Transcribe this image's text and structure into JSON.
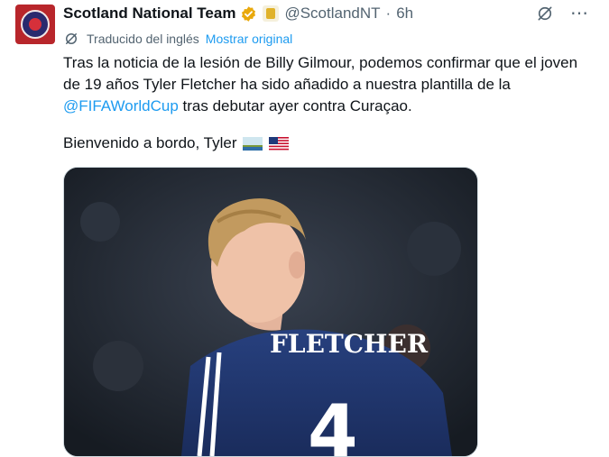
{
  "account": {
    "name": "Scotland National Team",
    "handle": "@ScotlandNT",
    "separator": "·",
    "time": "6h"
  },
  "icons": {
    "verified": "verified-badge-icon",
    "org": "affiliate-badge-icon",
    "grok": "grok-icon",
    "more": "more-icon",
    "translate": "translate-icon"
  },
  "translation": {
    "label": "Traducido del inglés",
    "show_original": "Mostrar original"
  },
  "tweet": {
    "line1": "Tras la noticia de la lesión de Billy Gilmour, podemos confirmar que el joven",
    "line2": "de 19 años Tyler Fletcher ha sido añadido a nuestra plantilla de la",
    "hashtag": "@FIFAWorldCup",
    "line3_rest": " tras debutar ayer contra Curaçao.",
    "welcome": "Bienvenido a bordo, Tyler"
  },
  "media": {
    "jersey_name": "FLETCHER",
    "jersey_number": "4"
  },
  "colors": {
    "accent": "#1d9bf0",
    "secondary_text": "#536471",
    "verified": "#e9a90c"
  }
}
